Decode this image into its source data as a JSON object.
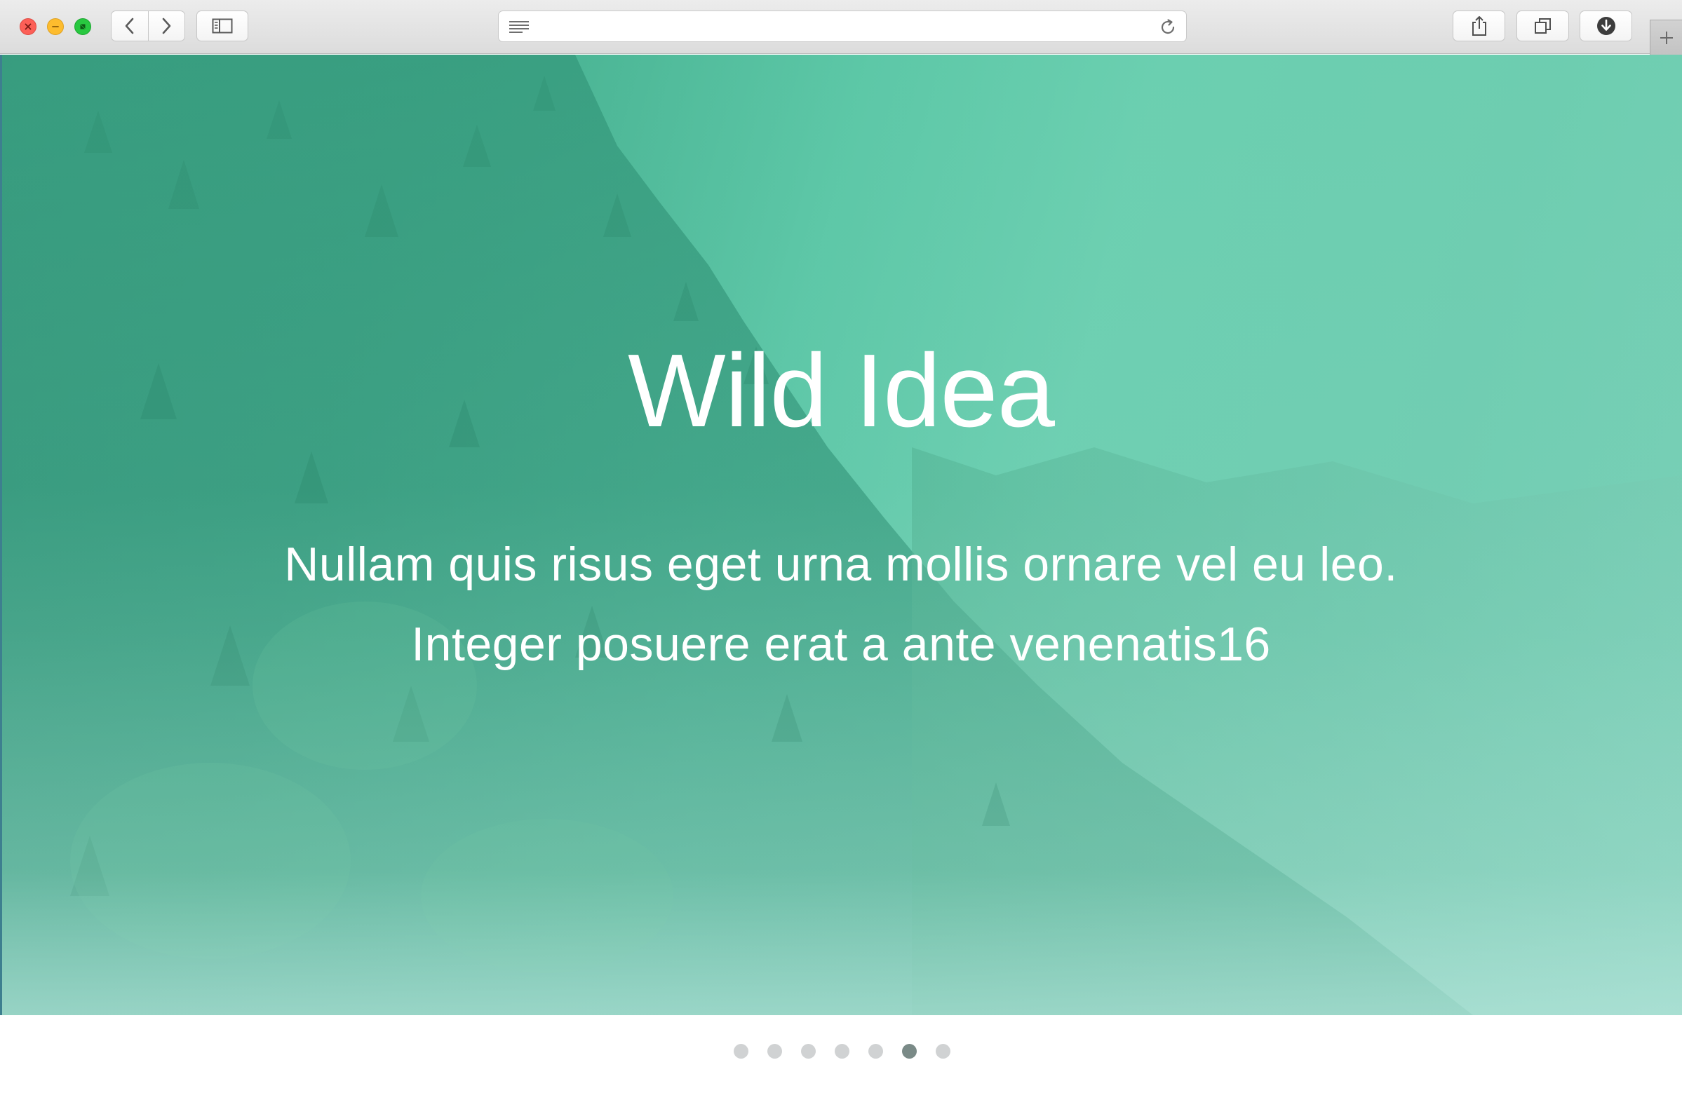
{
  "window": {
    "controls": [
      "close",
      "minimize",
      "fullscreen"
    ],
    "new_tab_icon": "plus-icon"
  },
  "toolbar": {
    "back_icon": "chevron-left-icon",
    "forward_icon": "chevron-right-icon",
    "sidebar_icon": "sidebar-icon",
    "share_icon": "share-icon",
    "tabs_icon": "tabs-overview-icon",
    "downloads_icon": "download-icon"
  },
  "address_bar": {
    "value": "",
    "placeholder": "",
    "reader_icon": "reader-icon",
    "reload_icon": "reload-icon"
  },
  "hero": {
    "title": "Wild Idea",
    "subtitle_line1": "Nullam quis risus eget urna mollis ornare vel eu leo.",
    "subtitle_line2": "Integer posuere erat a ante venenatis16"
  },
  "pagination": {
    "count": 7,
    "active_index": 5
  },
  "colors": {
    "hero_accent": "#5cc6a6",
    "dot_inactive": "#d0d2d3",
    "dot_active": "#7a8a87",
    "title_text": "#ffffff"
  }
}
